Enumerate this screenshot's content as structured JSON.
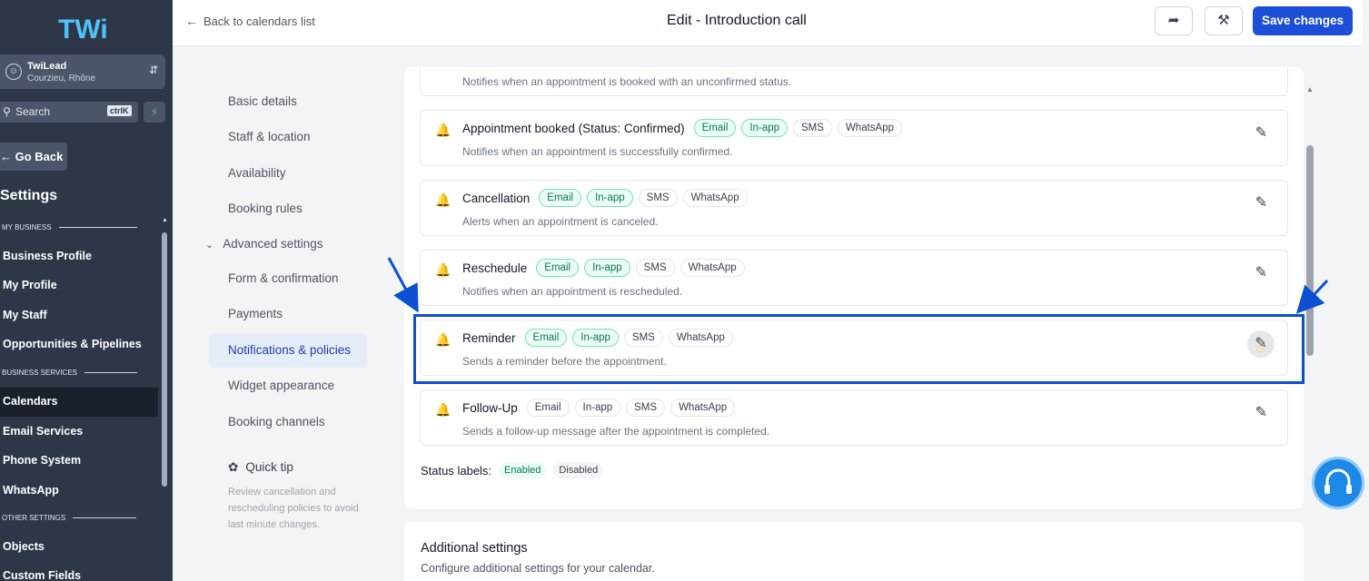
{
  "sidebar": {
    "logo_text": "TWi",
    "account_name": "TwiLead",
    "account_location": "Courzieu, Rhône",
    "search_placeholder": "Search",
    "search_shortcut": "ctrlK",
    "go_back": "Go Back",
    "settings_title": "Settings",
    "sections": {
      "my_business": "MY BUSINESS",
      "business_services": "BUSINESS SERVICES",
      "other_settings": "OTHER SETTINGS"
    },
    "items": {
      "business_profile": "Business Profile",
      "my_profile": "My Profile",
      "my_staff": "My Staff",
      "opportunities": "Opportunities & Pipelines",
      "calendars": "Calendars",
      "email_services": "Email Services",
      "phone_system": "Phone System",
      "whatsapp": "WhatsApp",
      "objects": "Objects",
      "custom_fields": "Custom Fields"
    }
  },
  "header": {
    "back_label": "Back to calendars list",
    "title": "Edit - Introduction call",
    "save_label": "Save changes"
  },
  "subnav": {
    "basic_details": "Basic details",
    "staff_location": "Staff & location",
    "availability": "Availability",
    "booking_rules": "Booking rules",
    "advanced_settings": "Advanced settings",
    "form_confirmation": "Form & confirmation",
    "payments": "Payments",
    "notifications": "Notifications & policies",
    "widget_appearance": "Widget appearance",
    "booking_channels": "Booking channels",
    "tip_title": "Quick tip",
    "tip_text": "Review cancellation and rescheduling policies to avoid last minute changes."
  },
  "notifications": {
    "partial_desc": "Notifies when an appointment is booked with an unconfirmed status.",
    "rows": [
      {
        "title": "Appointment booked (Status: Confirmed)",
        "desc": "Notifies when an appointment is successfully confirmed.",
        "email": "Email",
        "inapp": "In-app",
        "sms": "SMS",
        "whatsapp": "WhatsApp"
      },
      {
        "title": "Cancellation",
        "desc": "Alerts when an appointment is canceled.",
        "email": "Email",
        "inapp": "In-app",
        "sms": "SMS",
        "whatsapp": "WhatsApp"
      },
      {
        "title": "Reschedule",
        "desc": "Notifies when an appointment is rescheduled.",
        "email": "Email",
        "inapp": "In-app",
        "sms": "SMS",
        "whatsapp": "WhatsApp"
      },
      {
        "title": "Reminder",
        "desc": "Sends a reminder before the appointment.",
        "email": "Email",
        "inapp": "In-app",
        "sms": "SMS",
        "whatsapp": "WhatsApp"
      },
      {
        "title": "Follow-Up",
        "desc": "Sends a follow-up message after the appointment is completed.",
        "email": "Email",
        "inapp": "In-app",
        "sms": "SMS",
        "whatsapp": "WhatsApp"
      }
    ],
    "status_labels": "Status labels:",
    "enabled": "Enabled",
    "disabled": "Disabled"
  },
  "additional": {
    "title": "Additional settings",
    "desc": "Configure additional settings for your calendar."
  },
  "colors": {
    "sidebar_bg": "#2d3748",
    "accent": "#1d4ed8",
    "enabled_green": "#047857",
    "highlight_blue": "#0b4fd3"
  }
}
